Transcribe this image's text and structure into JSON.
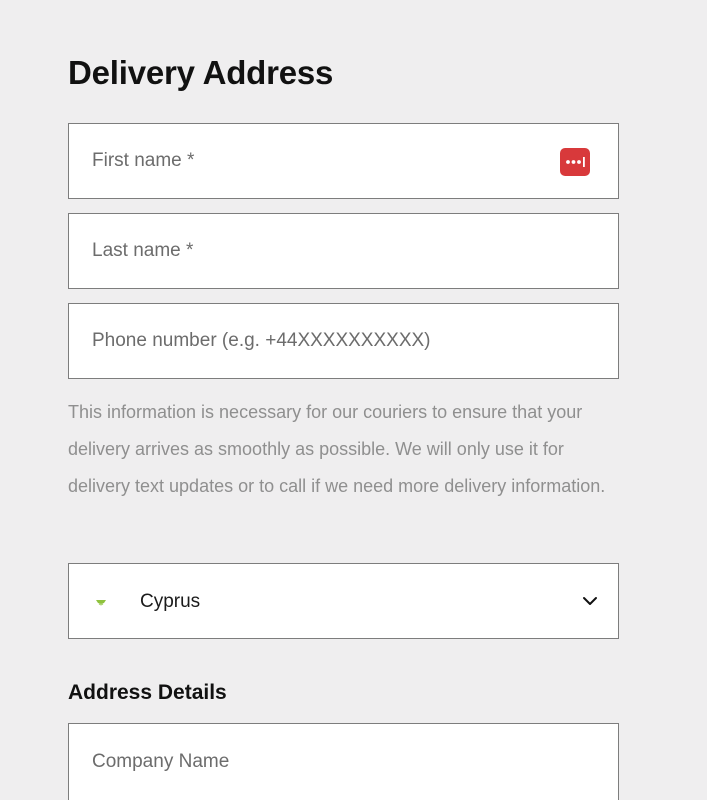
{
  "page": {
    "title": "Delivery Address"
  },
  "form": {
    "first_name": {
      "placeholder": "First name *",
      "value": ""
    },
    "last_name": {
      "placeholder": "Last name *",
      "value": ""
    },
    "phone": {
      "placeholder": "Phone number (e.g. +44XXXXXXXXXX)",
      "value": ""
    },
    "helper_text": "This information is necessary for our couriers to ensure that your delivery arrives as smoothly as possible. We will only use it for delivery text updates or to call if we need more delivery information.",
    "country": {
      "selected": "Cyprus",
      "flag_icon": "cyprus-flag-icon"
    },
    "address_details_heading": "Address Details",
    "company_name": {
      "placeholder": "Company Name",
      "value": ""
    }
  },
  "icons": {
    "password_manager": "password-manager-icon",
    "dropdown": "chevron-down-icon"
  },
  "colors": {
    "background": "#efeeef",
    "field_border": "#7d7d7d",
    "password_manager_icon": "#d8393b",
    "helper_text": "#8f8f8f",
    "cyprus_flag_green": "#8fc23d"
  }
}
